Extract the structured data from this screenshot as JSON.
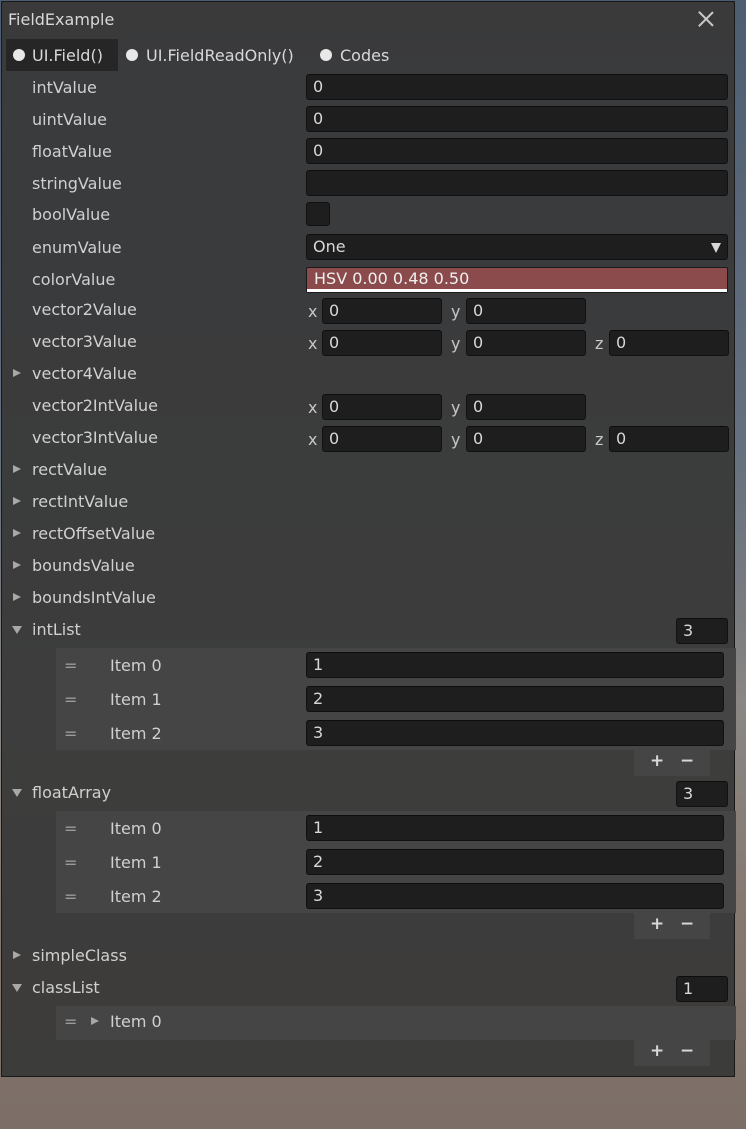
{
  "window": {
    "title": "FieldExample"
  },
  "tabs": [
    {
      "label": "UI.Field()"
    },
    {
      "label": "UI.FieldReadOnly()"
    },
    {
      "label": "Codes"
    }
  ],
  "fields": {
    "intValue": {
      "label": "intValue",
      "value": "0"
    },
    "uintValue": {
      "label": "uintValue",
      "value": "0"
    },
    "floatValue": {
      "label": "floatValue",
      "value": "0"
    },
    "stringValue": {
      "label": "stringValue",
      "value": ""
    },
    "boolValue": {
      "label": "boolValue",
      "checked": false
    },
    "enumValue": {
      "label": "enumValue",
      "value": "One"
    },
    "colorValue": {
      "label": "colorValue",
      "text": "HSV 0.00 0.48 0.50",
      "color": "#8b4b4c"
    },
    "vector2Value": {
      "label": "vector2Value",
      "x": "0",
      "y": "0"
    },
    "vector3Value": {
      "label": "vector3Value",
      "x": "0",
      "y": "0",
      "z": "0"
    },
    "vector4Value": {
      "label": "vector4Value"
    },
    "vector2IntValue": {
      "label": "vector2IntValue",
      "x": "0",
      "y": "0"
    },
    "vector3IntValue": {
      "label": "vector3IntValue",
      "x": "0",
      "y": "0",
      "z": "0"
    },
    "rectValue": {
      "label": "rectValue"
    },
    "rectIntValue": {
      "label": "rectIntValue"
    },
    "rectOffsetValue": {
      "label": "rectOffsetValue"
    },
    "boundsValue": {
      "label": "boundsValue"
    },
    "boundsIntValue": {
      "label": "boundsIntValue"
    },
    "simpleClass": {
      "label": "simpleClass"
    }
  },
  "axis": {
    "x": "x",
    "y": "y",
    "z": "z"
  },
  "intList": {
    "label": "intList",
    "count": "3",
    "items": [
      {
        "label": "Item 0",
        "value": "1"
      },
      {
        "label": "Item 1",
        "value": "2"
      },
      {
        "label": "Item 2",
        "value": "3"
      }
    ]
  },
  "floatArray": {
    "label": "floatArray",
    "count": "3",
    "items": [
      {
        "label": "Item 0",
        "value": "1"
      },
      {
        "label": "Item 1",
        "value": "2"
      },
      {
        "label": "Item 2",
        "value": "3"
      }
    ]
  },
  "classList": {
    "label": "classList",
    "count": "1",
    "items": [
      {
        "label": "Item 0"
      }
    ]
  },
  "list_controls": {
    "add": "+",
    "remove": "−",
    "handle": "="
  }
}
